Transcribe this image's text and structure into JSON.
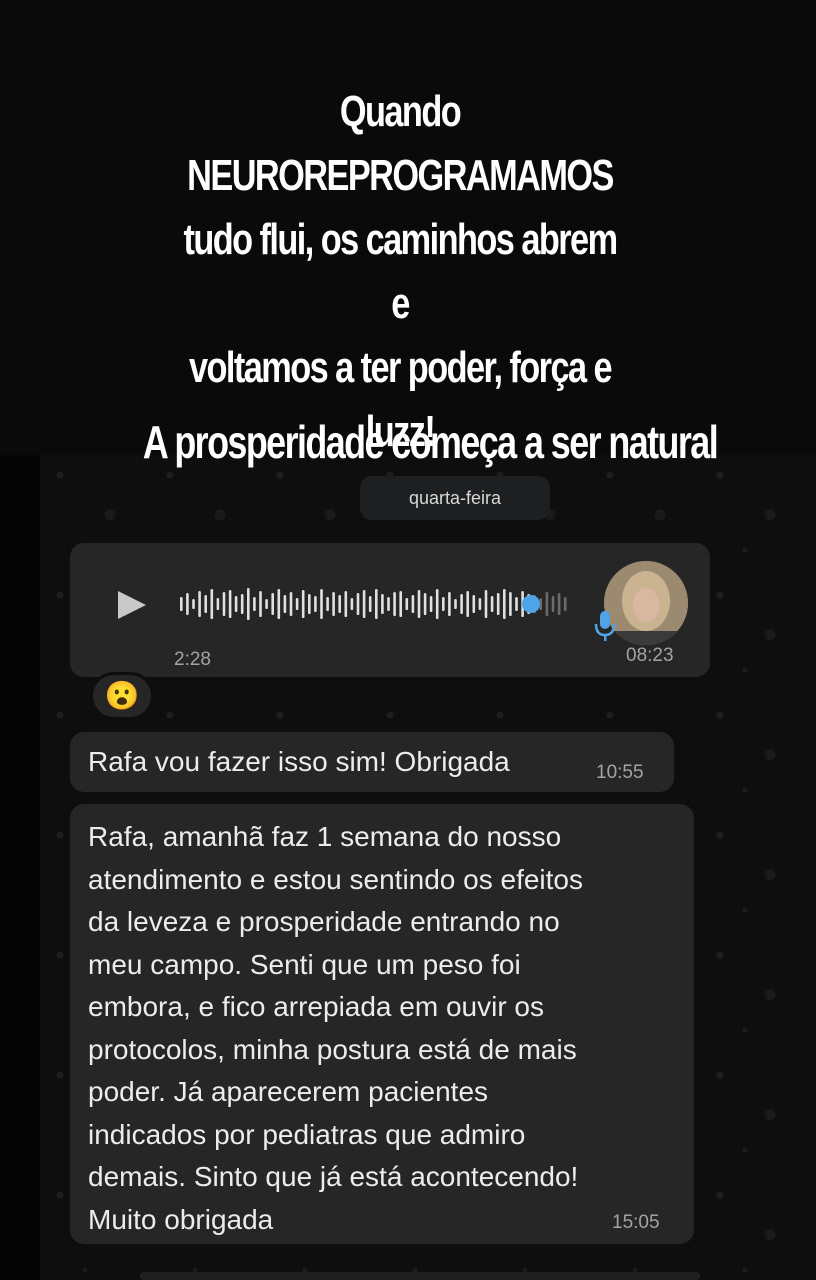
{
  "overlay": {
    "headline": "Quando NEUROREPROGRAMAMOS\ntudo flui, os caminhos abrem e\nvoltamos a ter poder, força e\nluzz!",
    "subline": "A prosperidade começa a ser natural"
  },
  "chat": {
    "date_separator": "quarta-feira",
    "audio_message": {
      "duration": "2:28",
      "time": "08:23",
      "progress": 0.9
    },
    "reaction_emoji": "😮",
    "messages": [
      {
        "text": "Rafa vou fazer isso sim! Obrigada",
        "time": "10:55"
      },
      {
        "text": "Rafa, amanhã faz 1 semana do nosso\natendimento e estou sentindo os efeitos\nda leveza e prosperidade entrando no\nmeu campo. Senti que um peso foi\nembora, e fico arrepiada em ouvir os\nprotocolos, minha postura está de mais\npoder. Já aparecerem pacientes\nindicados por pediatras que admiro\ndemais. Sinto que já está acontecendo!\nMuito obrigada",
        "time": "15:05"
      }
    ]
  },
  "colors": {
    "bubble": "#262626",
    "accent_blue": "#4fa3e8",
    "timestamp": "#a0a4a6"
  }
}
